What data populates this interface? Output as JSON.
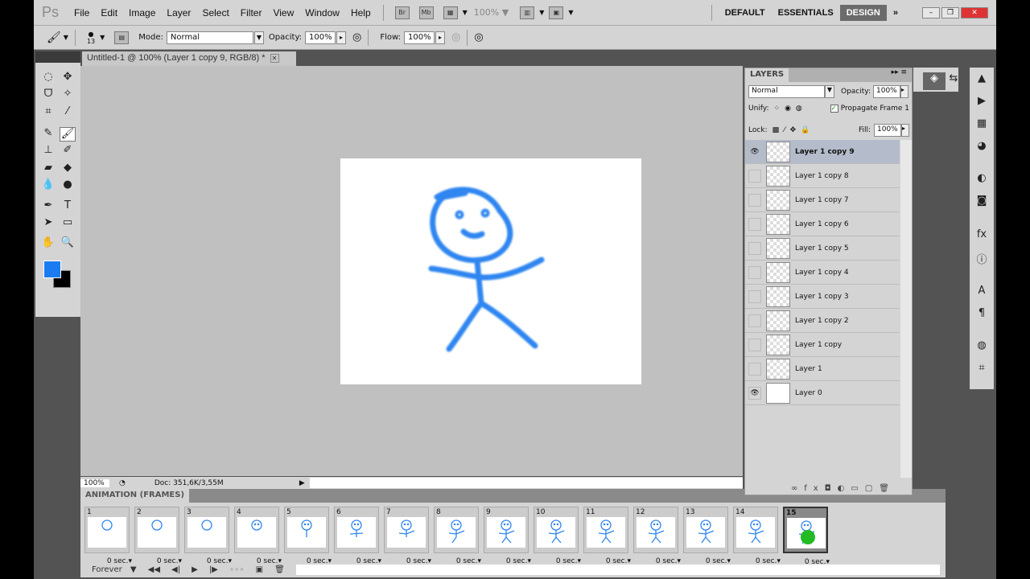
{
  "menubar": {
    "logo": "Ps",
    "items": [
      "File",
      "Edit",
      "Image",
      "Layer",
      "Select",
      "Filter",
      "View",
      "Window",
      "Help"
    ],
    "bridge": "Br",
    "minibridge": "Mb",
    "zoom": "100%",
    "workspaces": [
      "DEFAULT",
      "ESSENTIALS",
      "DESIGN"
    ],
    "active_workspace": "DESIGN"
  },
  "options": {
    "brush_size": "13",
    "mode_label": "Mode:",
    "mode": "Normal",
    "opacity_label": "Opacity:",
    "opacity": "100%",
    "flow_label": "Flow:",
    "flow": "100%"
  },
  "document": {
    "tab_title": "Untitled-1 @ 100% (Layer 1 copy 9, RGB/8) *",
    "zoom": "100%",
    "doc_info": "Doc: 351,6K/3,55M"
  },
  "colors": {
    "foreground": "#1a7cf0",
    "background": "#000000",
    "stroke": "#2f86f0"
  },
  "layers": {
    "title": "LAYERS",
    "blend": "Normal",
    "opacity_label": "Opacity:",
    "opacity": "100%",
    "unify_label": "Unify:",
    "propagate": "Propagate Frame 1",
    "propagate_checked": true,
    "lock_label": "Lock:",
    "fill_label": "Fill:",
    "fill": "100%",
    "items": [
      {
        "name": "Layer 1 copy 9",
        "visible": true,
        "selected": true
      },
      {
        "name": "Layer 1 copy 8",
        "visible": false
      },
      {
        "name": "Layer 1 copy 7",
        "visible": false
      },
      {
        "name": "Layer 1 copy 6",
        "visible": false
      },
      {
        "name": "Layer 1 copy 5",
        "visible": false
      },
      {
        "name": "Layer 1 copy 4",
        "visible": false
      },
      {
        "name": "Layer 1 copy 3",
        "visible": false
      },
      {
        "name": "Layer 1 copy 2",
        "visible": false
      },
      {
        "name": "Layer 1 copy",
        "visible": false
      },
      {
        "name": "Layer 1",
        "visible": false
      },
      {
        "name": "Layer 0",
        "visible": true
      }
    ]
  },
  "animation": {
    "title": "ANIMATION (FRAMES)",
    "loop": "Forever",
    "selected_frame": 15,
    "frames": [
      {
        "n": "1",
        "d": "0 sec."
      },
      {
        "n": "2",
        "d": "0 sec."
      },
      {
        "n": "3",
        "d": "0 sec."
      },
      {
        "n": "4",
        "d": "0 sec."
      },
      {
        "n": "5",
        "d": "0 sec."
      },
      {
        "n": "6",
        "d": "0 sec."
      },
      {
        "n": "7",
        "d": "0 sec."
      },
      {
        "n": "8",
        "d": "0 sec."
      },
      {
        "n": "9",
        "d": "0 sec."
      },
      {
        "n": "10",
        "d": "0 sec."
      },
      {
        "n": "11",
        "d": "0 sec."
      },
      {
        "n": "12",
        "d": "0 sec."
      },
      {
        "n": "13",
        "d": "0 sec."
      },
      {
        "n": "14",
        "d": "0 sec."
      },
      {
        "n": "15",
        "d": "0 sec."
      }
    ]
  }
}
